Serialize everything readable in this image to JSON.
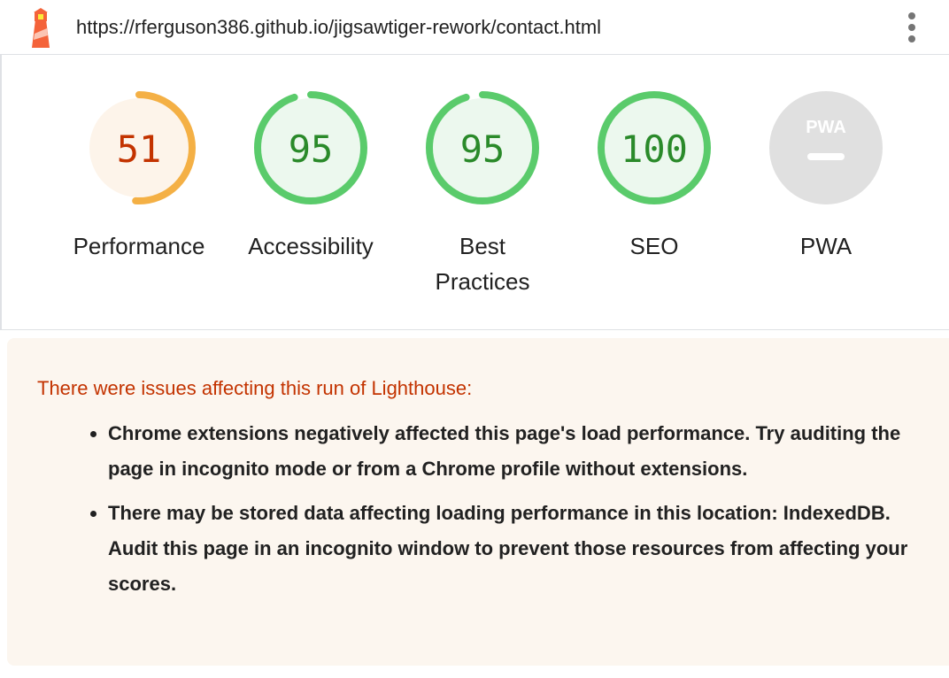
{
  "header": {
    "url": "https://rferguson386.github.io/jigsawtiger-rework/contact.html",
    "logo_icon": "lighthouse-icon",
    "menu_icon": "kebab-menu-icon"
  },
  "scores": [
    {
      "id": "performance",
      "label": "Performance",
      "score": 51,
      "status": "average"
    },
    {
      "id": "accessibility",
      "label": "Accessibility",
      "score": 95,
      "status": "pass"
    },
    {
      "id": "best-practices",
      "label": "Best Practices",
      "score": 95,
      "status": "pass"
    },
    {
      "id": "seo",
      "label": "SEO",
      "score": 100,
      "status": "pass"
    },
    {
      "id": "pwa",
      "label": "PWA",
      "score": null,
      "status": "not-applicable",
      "badge_text": "PWA"
    }
  ],
  "colors": {
    "average_arc": "#f4b045",
    "average_fill": "#fdf4ea",
    "average_text": "#c33300",
    "pass_arc": "#5acb6b",
    "pass_fill": "#ecf8ee",
    "pass_text": "#2a8a2a",
    "na_fill": "#e0e0e0",
    "warning_bg": "#fcf6ef",
    "warning_text": "#c33300"
  },
  "warnings": {
    "heading": "There were issues affecting this run of Lighthouse:",
    "items": [
      "Chrome extensions negatively affected this page's load performance. Try auditing the page in incognito mode or from a Chrome profile without extensions.",
      "There may be stored data affecting loading performance in this location: IndexedDB. Audit this page in an incognito window to prevent those resources from affecting your scores."
    ]
  }
}
